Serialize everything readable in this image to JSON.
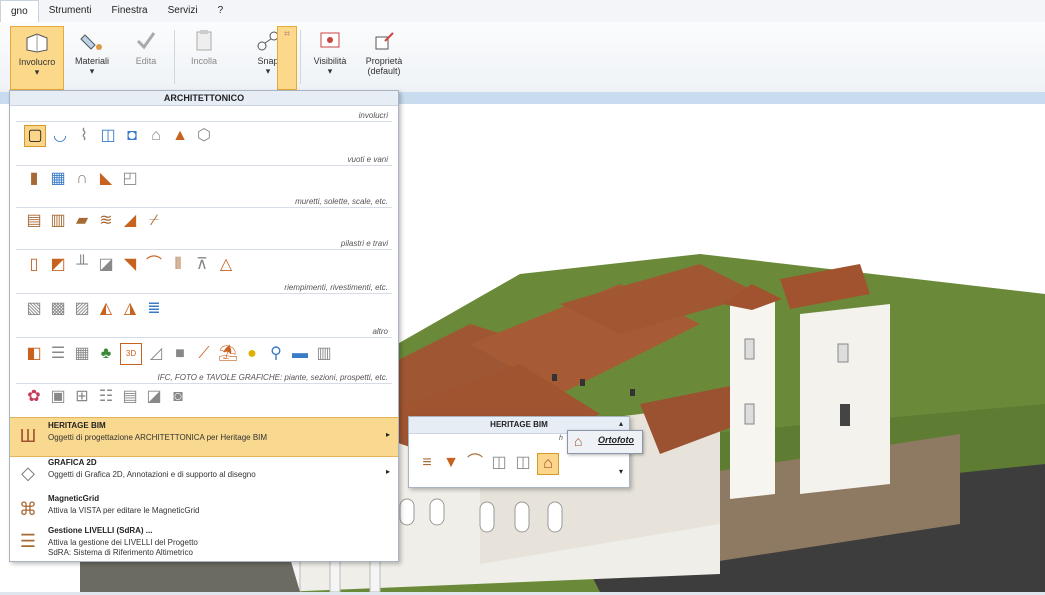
{
  "menubar": {
    "items": [
      "gno",
      "Strumenti",
      "Finestra",
      "Servizi",
      "?"
    ]
  },
  "ribbon": {
    "buttons": [
      {
        "label": "Involucro",
        "icon": "wall-box-icon"
      },
      {
        "label": "Materiali",
        "icon": "paint-bucket-icon"
      },
      {
        "label": "Edita",
        "icon": "edit-check-icon"
      },
      {
        "label": "Incolla",
        "icon": "paste-icon"
      },
      {
        "label": "Snap",
        "icon": "snap-icon"
      },
      {
        "label": "Visibilità",
        "icon": "visibility-icon"
      },
      {
        "label": "Proprietà",
        "sublabel": "(default)",
        "icon": "properties-icon"
      }
    ]
  },
  "dropdown": {
    "header": "ARCHITETTONICO",
    "sections": [
      {
        "label": "involucri"
      },
      {
        "label": "vuoti e vani"
      },
      {
        "label": "muretti, solette, scale, etc."
      },
      {
        "label": "pilastri e travi"
      },
      {
        "label": "riempimenti, rivestimenti, etc."
      },
      {
        "label": "altro"
      },
      {
        "label": "IFC, FOTO e TAVOLE GRAFICHE: piante, sezioni, prospetti, etc."
      }
    ],
    "menu_items": [
      {
        "title": "HERITAGE BIM",
        "desc": "Oggetti di progettazione ARCHITETTONICA per Heritage BIM",
        "arrow": "▸"
      },
      {
        "title": "GRAFICA 2D",
        "desc": "Oggetti di Grafica 2D, Annotazioni e di supporto al disegno",
        "arrow": "▸"
      },
      {
        "title": "MagneticGrid",
        "desc": "Attiva la VISTA per editare le MagneticGrid"
      },
      {
        "title": "Gestione LIVELLI (SdRA) ...",
        "desc": "Attiva la gestione dei LIVELLI del Progetto",
        "desc2": "SdRA: Sistema di Riferimento Altimetrico"
      }
    ]
  },
  "submenu": {
    "header": "HERITAGE BIM",
    "small_label": "h",
    "tooltip": "Ortofoto"
  },
  "colors": {
    "highlight": "#f9d88f",
    "roof": "#a0532e",
    "wall": "#f1efe9",
    "grass": "#6d8c3a"
  }
}
